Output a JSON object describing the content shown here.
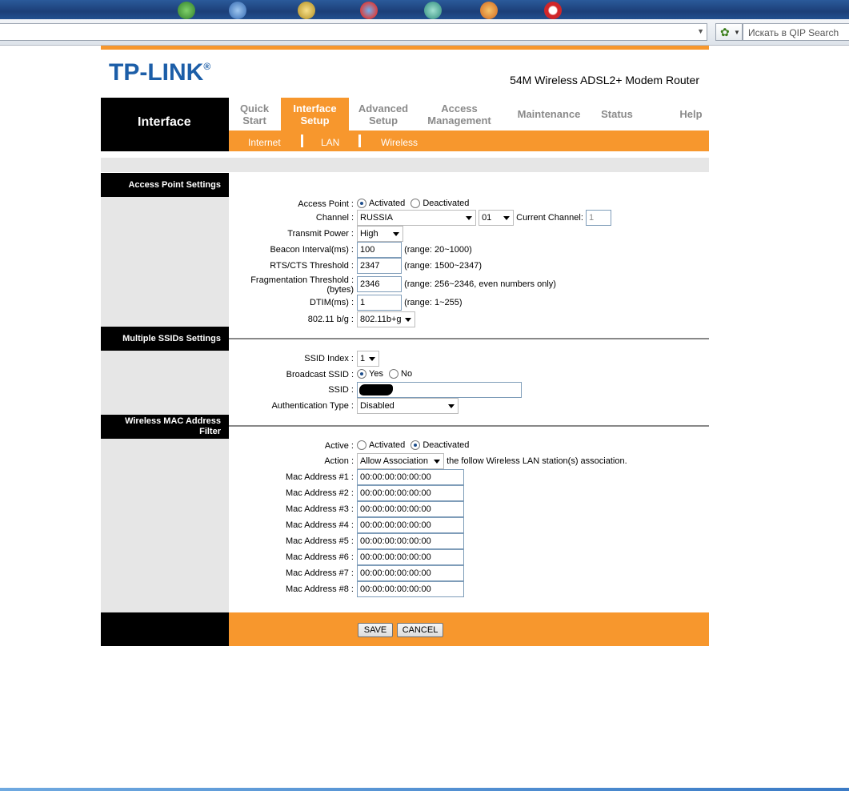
{
  "browser": {
    "search_placeholder": "Искать в QIP Search"
  },
  "brand": {
    "logo": "TP-LINK",
    "logo_mark": "®",
    "model": "54M Wireless ADSL2+ Modem Router",
    "accent_color": "#f7972d",
    "logo_color": "#1c5ea8"
  },
  "nav": {
    "section_title": "Interface",
    "tabs": [
      {
        "line1": "Quick",
        "line2": "Start"
      },
      {
        "line1": "Interface",
        "line2": "Setup"
      },
      {
        "line1": "Advanced",
        "line2": "Setup"
      },
      {
        "line1": "Access",
        "line2": "Management"
      },
      {
        "line1": "Maintenance",
        "line2": ""
      },
      {
        "line1": "Status",
        "line2": ""
      },
      {
        "line1": "Help",
        "line2": ""
      }
    ],
    "subtabs": [
      "Internet",
      "LAN",
      "Wireless"
    ]
  },
  "access_point": {
    "header": "Access Point Settings",
    "access_point_label": "Access Point :",
    "activated": "Activated",
    "deactivated": "Deactivated",
    "channel_label": "Channel :",
    "channel_country": "RUSSIA",
    "channel_number": "01",
    "current_channel_label": "Current Channel:",
    "current_channel_value": "1",
    "tx_power_label": "Transmit Power :",
    "tx_power_value": "High",
    "beacon_label": "Beacon Interval(ms) :",
    "beacon_value": "100",
    "beacon_range": "(range: 20~1000)",
    "rts_label": "RTS/CTS Threshold :",
    "rts_value": "2347",
    "rts_range": "(range: 1500~2347)",
    "frag_label_1": "Fragmentation Threshold :",
    "frag_label_2": "(bytes)",
    "frag_value": "2346",
    "frag_range": "(range: 256~2346, even numbers only)",
    "dtim_label": "DTIM(ms) :",
    "dtim_value": "1",
    "dtim_range": "(range: 1~255)",
    "mode_label": "802.11 b/g :",
    "mode_value": "802.11b+g"
  },
  "ssid": {
    "header": "Multiple SSIDs Settings",
    "index_label": "SSID Index :",
    "index_value": "1",
    "broadcast_label": "Broadcast SSID :",
    "yes": "Yes",
    "no": "No",
    "ssid_label": "SSID :",
    "auth_label": "Authentication Type :",
    "auth_value": "Disabled"
  },
  "mac_filter": {
    "header_1": "Wireless MAC Address",
    "header_2": "Filter",
    "active_label": "Active :",
    "activated": "Activated",
    "deactivated": "Deactivated",
    "action_label": "Action :",
    "action_value": "Allow Association",
    "action_suffix": "the follow Wireless LAN station(s) association.",
    "entries": [
      {
        "label": "Mac Address #1 :",
        "value": "00:00:00:00:00:00"
      },
      {
        "label": "Mac Address #2 :",
        "value": "00:00:00:00:00:00"
      },
      {
        "label": "Mac Address #3 :",
        "value": "00:00:00:00:00:00"
      },
      {
        "label": "Mac Address #4 :",
        "value": "00:00:00:00:00:00"
      },
      {
        "label": "Mac Address #5 :",
        "value": "00:00:00:00:00:00"
      },
      {
        "label": "Mac Address #6 :",
        "value": "00:00:00:00:00:00"
      },
      {
        "label": "Mac Address #7 :",
        "value": "00:00:00:00:00:00"
      },
      {
        "label": "Mac Address #8 :",
        "value": "00:00:00:00:00:00"
      }
    ]
  },
  "actions": {
    "save": "SAVE",
    "cancel": "CANCEL"
  }
}
